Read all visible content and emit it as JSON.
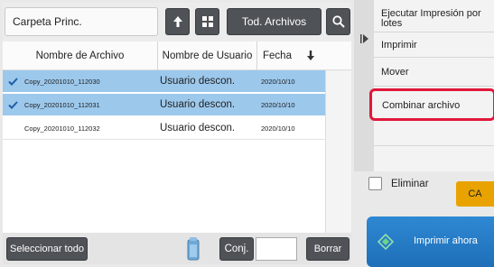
{
  "toolbar": {
    "folder_label": "Carpeta Princ.",
    "filter_label": "Tod. Archivos"
  },
  "table": {
    "headers": {
      "name": "Nombre de Archivo",
      "user": "Nombre de Usuario",
      "date": "Fecha"
    },
    "rows": [
      {
        "name": "Copy_20201010_112030",
        "user": "Usuario descon.",
        "date": "2020/10/10",
        "selected": true
      },
      {
        "name": "Copy_20201010_112031",
        "user": "Usuario descon.",
        "date": "2020/10/10",
        "selected": true
      },
      {
        "name": "Copy_20201010_112032",
        "user": "Usuario descon.",
        "date": "2020/10/10",
        "selected": false
      }
    ]
  },
  "bottom": {
    "select_all_label": "Seleccionar todo",
    "conj_label": "Conj.",
    "conj_value": "",
    "delete_label": "Borrar"
  },
  "side_menu": {
    "items": [
      {
        "label": "Ejecutar Impresión por lotes"
      },
      {
        "label": "Imprimir"
      },
      {
        "label": "Mover"
      },
      {
        "label": "Combinar archivo",
        "highlighted": true
      }
    ],
    "delete_checkbox_label": "Eliminar",
    "delete_checked": false,
    "ca_label": "CA",
    "print_now_label": "Imprimir ahora"
  },
  "colors": {
    "selected_row": "#9cc8ec",
    "highlight_border": "#e0173a",
    "ca_button": "#e8a300",
    "print_now": "#1e6fb8",
    "dark_button": "#4f5257"
  },
  "icons": {
    "up": "arrow-up-icon",
    "grid": "grid-view-icon",
    "search": "search-icon",
    "sort": "sort-down-icon",
    "check": "checkmark-icon",
    "toner": "toner-icon",
    "collapse": "panel-collapse-icon",
    "print_now": "start-diamond-icon"
  }
}
